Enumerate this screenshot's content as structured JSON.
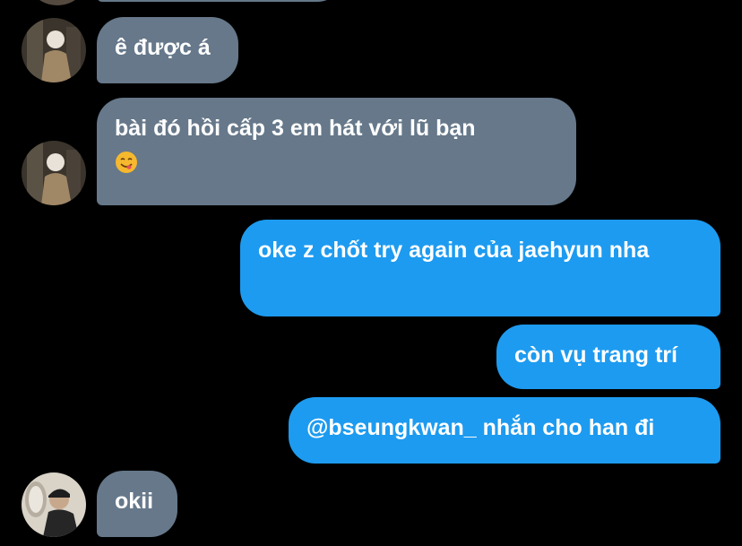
{
  "conversation": {
    "messages": [
      {
        "sender": "other",
        "text": "ê được á"
      },
      {
        "sender": "other",
        "text": "bài đó hồi cấp 3 em hát với lũ bạn",
        "emoji": "smiling-face-with-tongue-emoji"
      },
      {
        "sender": "self",
        "text": "oke z chốt try again của jaehyun nha"
      },
      {
        "sender": "self",
        "text": "còn vụ trang trí"
      },
      {
        "sender": "self",
        "text": "@bseungkwan_ nhắn cho han đi"
      },
      {
        "sender": "other",
        "text": "okii"
      }
    ]
  },
  "colors": {
    "background": "#000000",
    "incoming_bubble": "#66788a",
    "outgoing_bubble": "#1d9bf0",
    "text": "#ffffff"
  },
  "icons": {
    "avatar_1": "avatar-photo",
    "avatar_2": "avatar-photo",
    "avatar_3": "avatar-photo"
  }
}
